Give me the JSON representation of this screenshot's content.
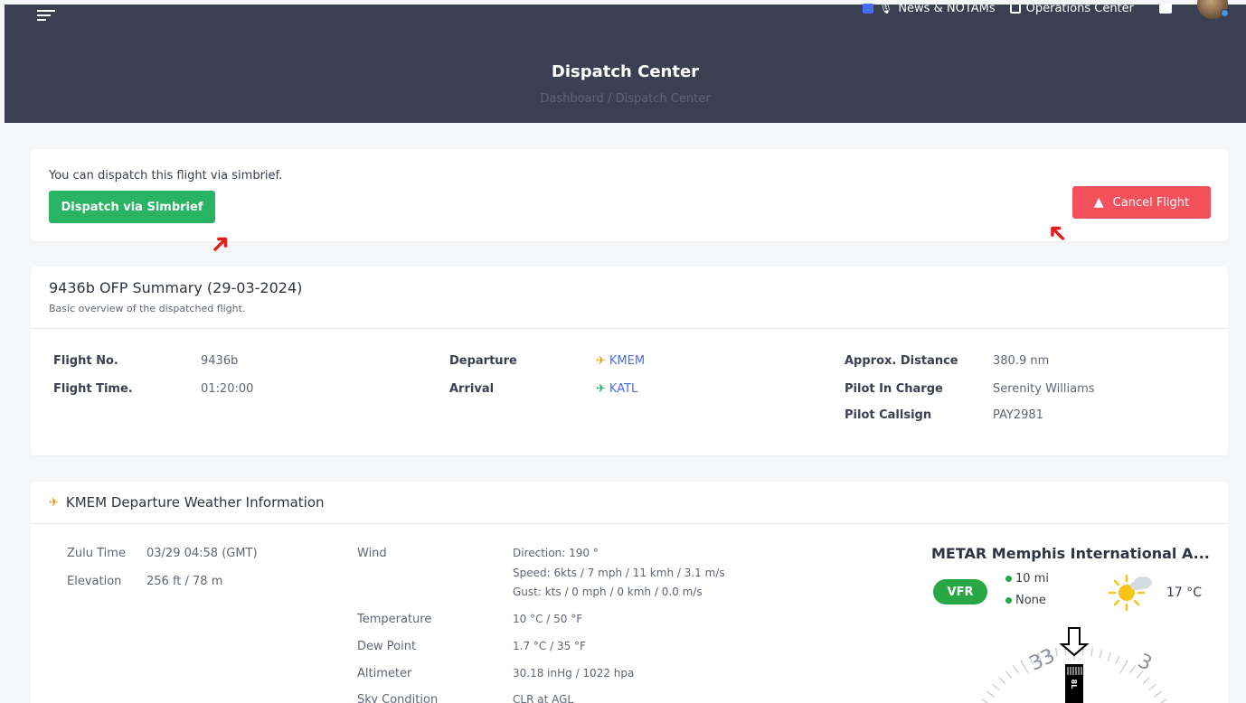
{
  "header": {
    "nav": {
      "news_label": "News & NOTAMs",
      "ops_label": "Operations Center"
    },
    "page_title": "Dispatch Center",
    "breadcrumb": "Dashboard / Dispatch Center"
  },
  "dispatch": {
    "info_text": "You can dispatch this flight via simbrief.",
    "dispatch_button": "Dispatch via Simbrief",
    "cancel_button": "Cancel Flight"
  },
  "ofp": {
    "title": "9436b OFP Summary (29-03-2024)",
    "subtitle": "Basic overview of the dispatched flight.",
    "flight_no_label": "Flight No.",
    "flight_no": "9436b",
    "flight_time_label": "Flight Time.",
    "flight_time": "01:20:00",
    "departure_label": "Departure",
    "departure": "KMEM",
    "arrival_label": "Arrival",
    "arrival": "KATL",
    "distance_label": "Approx. Distance",
    "distance": "380.9 nm",
    "pic_label": "Pilot In Charge",
    "pic": "Serenity Williams",
    "callsign_label": "Pilot Callsign",
    "callsign": "PAY2981"
  },
  "weather": {
    "title": "KMEM Departure Weather Information",
    "zulu_label": "Zulu Time",
    "zulu": "03/29 04:58 (GMT)",
    "elevation_label": "Elevation",
    "elevation": "256 ft / 78 m",
    "wind_label": "Wind",
    "wind_direction": "Direction: 190 °",
    "wind_speed": "Speed: 6kts / 7 mph / 11 kmh / 3.1 m/s",
    "wind_gust": "Gust: kts / 0 mph / 0 kmh / 0.0 m/s",
    "temperature_label": "Temperature",
    "temperature": "10 °C / 50 °F",
    "dewpoint_label": "Dew Point",
    "dewpoint": "1.7 °C / 35 °F",
    "altimeter_label": "Altimeter",
    "altimeter": "30.18 inHg / 1022 hpa",
    "sky_label": "Sky Condition",
    "sky": "CLR at AGL",
    "metar_title": "METAR Memphis International A...",
    "flight_rules": "VFR",
    "visibility": "10 mi",
    "ceiling": "None",
    "temp_badge": "17 °C",
    "runway_labels": [
      "33",
      "3"
    ]
  },
  "colors": {
    "header_bg": "#3a3f51",
    "green": "#28b463",
    "red": "#f3525d",
    "link": "#4a6cf7",
    "departure_icon": "#f39c12"
  }
}
